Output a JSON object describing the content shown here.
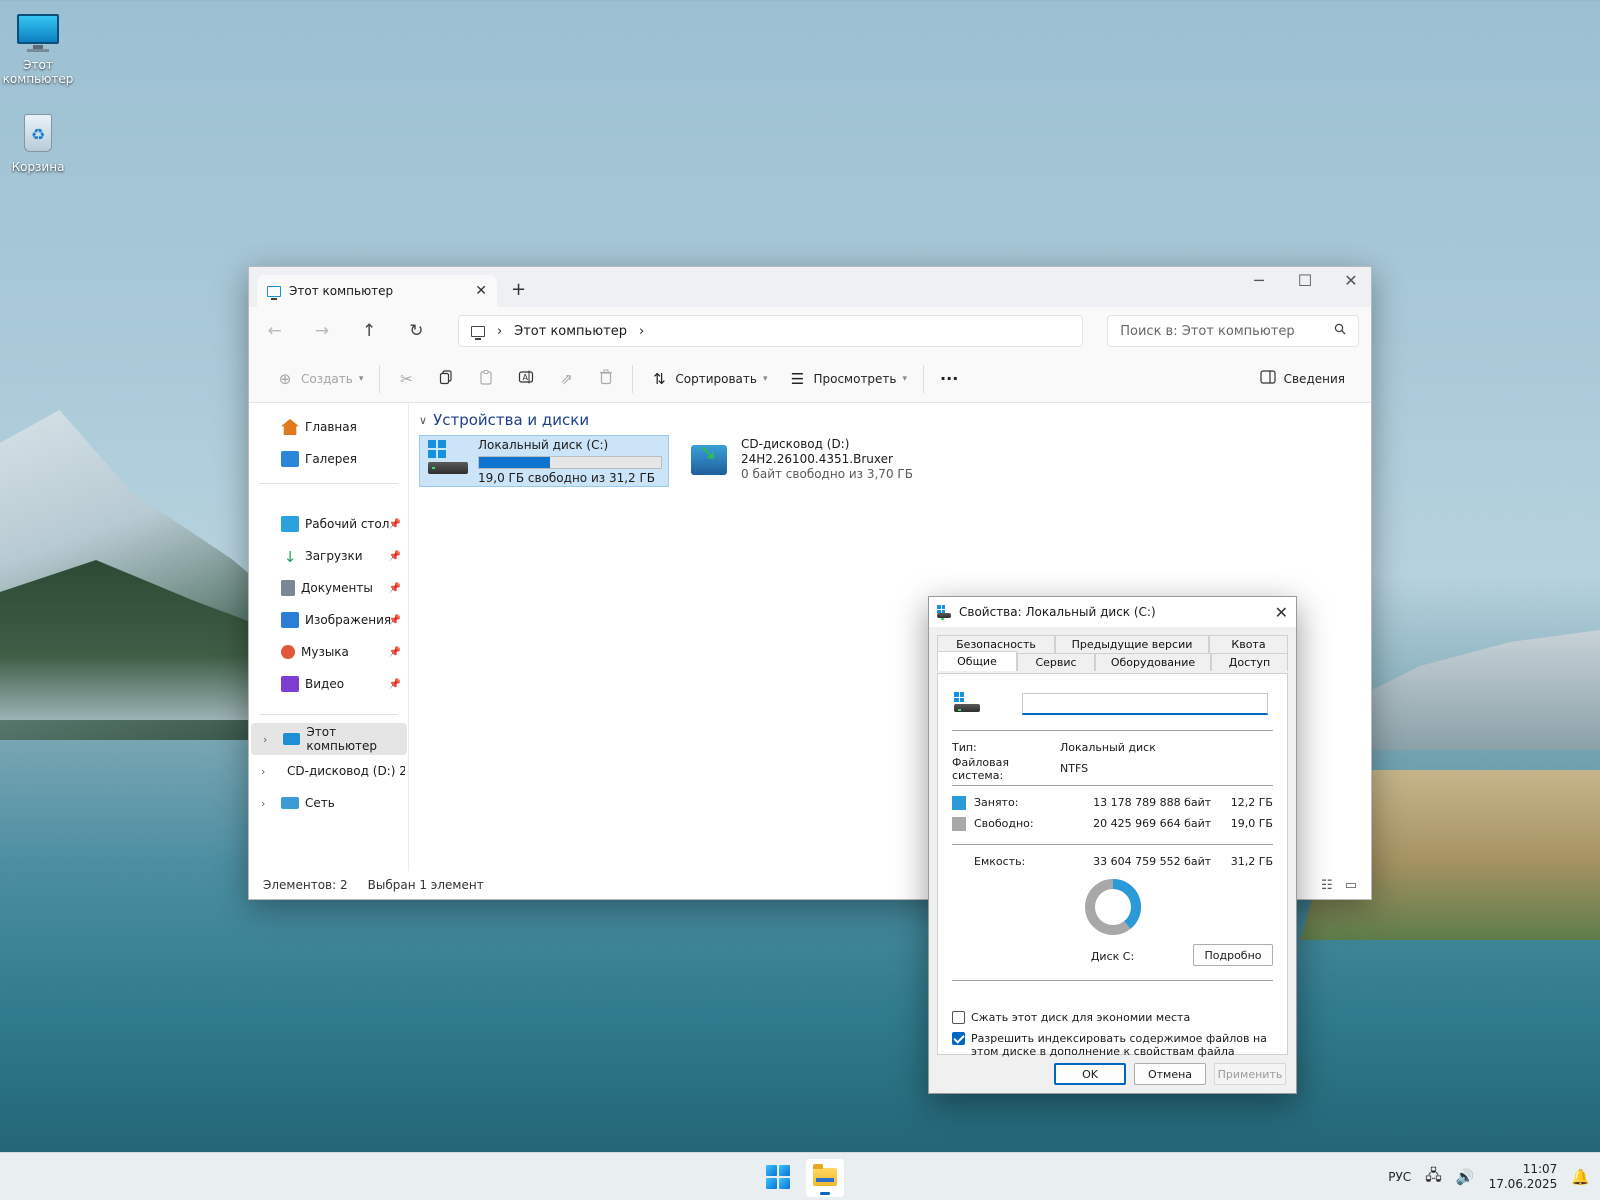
{
  "desktop": {
    "icons": [
      {
        "label": "Этот компьютер"
      },
      {
        "label": "Корзина"
      }
    ]
  },
  "explorer": {
    "tab_title": "Этот компьютер",
    "new_tab": "+",
    "window_controls": {
      "minimize": "─",
      "maximize": "☐",
      "close": "✕"
    },
    "nav": {
      "back": "←",
      "forward": "→",
      "up": "↑",
      "refresh": "↻"
    },
    "address": {
      "chevron": "›",
      "location": "Этот компьютер"
    },
    "search_placeholder": "Поиск в: Этот компьютер",
    "toolbar": {
      "create": "Создать",
      "sort": "Сортировать",
      "view": "Просмотреть",
      "more": "···",
      "details": "Сведения"
    },
    "sidebar": {
      "top": [
        {
          "label": "Главная",
          "color": "#e07a1f"
        },
        {
          "label": "Галерея",
          "color": "#2b86d9"
        }
      ],
      "pinned": [
        {
          "label": "Рабочий стол",
          "color": "#2aa0dc"
        },
        {
          "label": "Загрузки",
          "color": "#1b9f62"
        },
        {
          "label": "Документы",
          "color": "#7b8796"
        },
        {
          "label": "Изображения",
          "color": "#2b7fd9"
        },
        {
          "label": "Музыка",
          "color": "#e0563c"
        },
        {
          "label": "Видео",
          "color": "#7c3fd1"
        }
      ],
      "tree": [
        {
          "label": "Этот компьютер"
        },
        {
          "label": "CD-дисковод (D:) 2"
        },
        {
          "label": "Сеть"
        }
      ]
    },
    "group_title": "Устройства и диски",
    "drives": [
      {
        "name": "Локальный диск (C:)",
        "used_fraction": 0.39,
        "free_text": "19,0 ГБ свободно из 31,2 ГБ"
      },
      {
        "name": "CD-дисковод (D:)",
        "subtitle": "24H2.26100.4351.Bruxer",
        "free_text": "0 байт свободно из 3,70 ГБ"
      }
    ],
    "status": {
      "items": "Элементов: 2",
      "selected": "Выбран 1 элемент"
    }
  },
  "dialog": {
    "title": "Свойства: Локальный диск (C:)",
    "tabs_row1": [
      "Безопасность",
      "Предыдущие версии",
      "Квота"
    ],
    "tabs_row2": [
      "Общие",
      "Сервис",
      "Оборудование",
      "Доступ"
    ],
    "active_tab": "Общие",
    "label_value": "",
    "type_label": "Тип:",
    "type_value": "Локальный диск",
    "fs_label": "Файловая система:",
    "fs_value": "NTFS",
    "used_label": "Занято:",
    "used_bytes": "13 178 789 888 байт",
    "used_gb": "12,2 ГБ",
    "free_label": "Свободно:",
    "free_bytes": "20 425 969 664 байт",
    "free_gb": "19,0 ГБ",
    "capacity_label": "Емкость:",
    "capacity_bytes": "33 604 759 552 байт",
    "capacity_gb": "31,2 ГБ",
    "used_fraction": 0.392,
    "disk_label": "Диск C:",
    "details_button": "Подробно",
    "compress_label": "Сжать этот диск для экономии места",
    "compress_checked": false,
    "index_label": "Разрешить индексировать содержимое файлов на этом диске в дополнение к свойствам файла",
    "index_checked": true,
    "buttons": {
      "ok": "OK",
      "cancel": "Отмена",
      "apply": "Применить"
    },
    "colors": {
      "used": "#2a9ad8",
      "free": "#a8a8a8"
    }
  },
  "taskbar": {
    "language": "РУС",
    "time": "11:07",
    "date": "17.06.2025"
  }
}
